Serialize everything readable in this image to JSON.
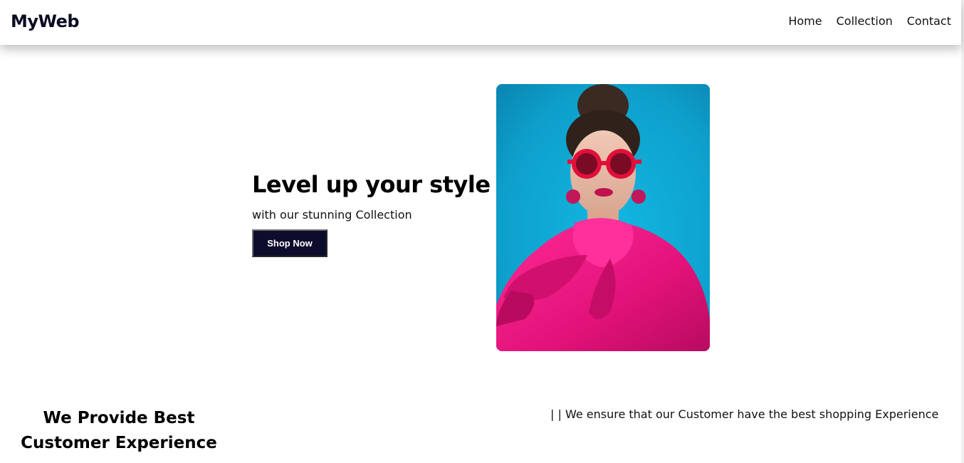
{
  "navbar": {
    "brand": "MyWeb",
    "links": [
      {
        "label": "Home"
      },
      {
        "label": "Collection"
      },
      {
        "label": "Contact"
      }
    ]
  },
  "hero": {
    "title": "Level up your style",
    "subtitle": "with our stunning Collection",
    "cta_label": "Shop Now"
  },
  "experience": {
    "heading": "We Provide Best Customer Experience",
    "text": "| | We ensure that our Customer have the best shopping Experience"
  },
  "colors": {
    "brand_dark": "#0c0c2c",
    "image_bg": "#12a9d6",
    "image_subject": "#e8177a"
  }
}
